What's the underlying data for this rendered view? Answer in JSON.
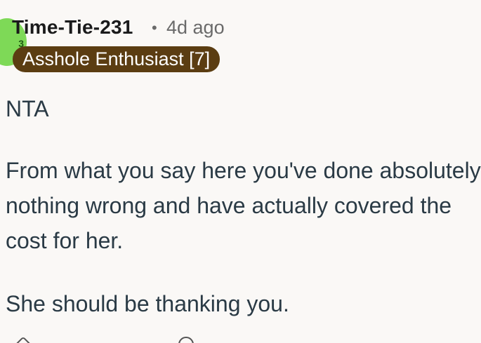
{
  "comment": {
    "author": "Time-Tie-231",
    "separator": "•",
    "timestamp": "4d ago",
    "flair": "Asshole Enthusiast [7]",
    "paragraphs": [
      "NTA",
      "From what you say here you've  done absolutely nothing wrong and have actually covered the cost for her.",
      "She should be thanking you."
    ],
    "avatar_color": "#7ed957",
    "flair_color": "#5b3d12",
    "action_icons": [
      "upvote-icon",
      "comment-icon"
    ]
  }
}
